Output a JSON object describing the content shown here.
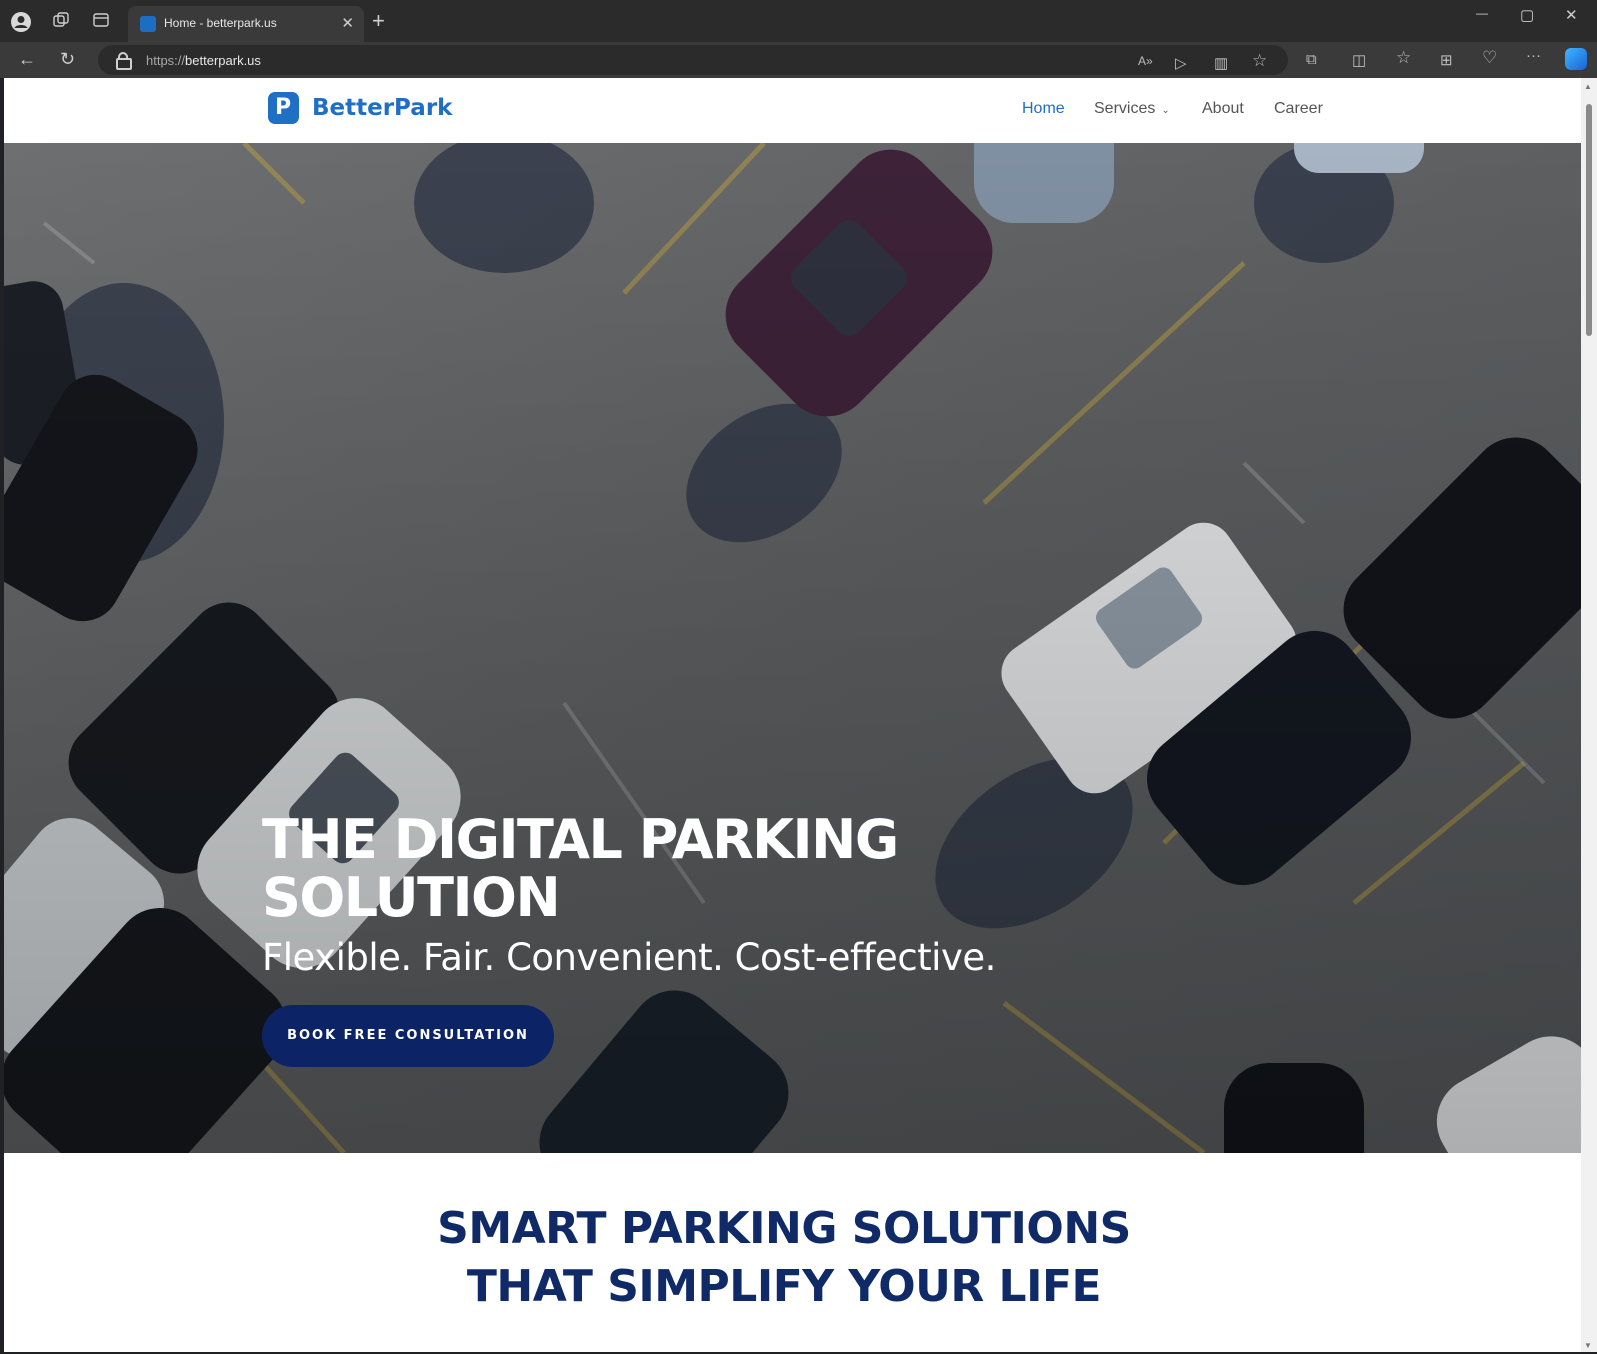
{
  "browser": {
    "tab_title": "Home - betterpark.us",
    "url_protocol": "https://",
    "url_domain": "betterpark.us",
    "icons": {
      "profile": "profile-icon",
      "workspaces": "workspaces-icon",
      "tab_actions": "tab-actions-icon",
      "new_tab": "plus-icon",
      "back": "back-arrow-icon",
      "refresh": "refresh-icon",
      "lock": "lock-icon",
      "read_aloud": "read-aloud-icon",
      "extensions": "puzzle-icon",
      "split_screen": "split-screen-icon",
      "favorites": "favorites-icon",
      "collections": "collections-icon",
      "browser_essentials": "heart-pulse-icon",
      "more": "more-dots-icon",
      "copilot": "copilot-icon"
    },
    "glyphs": {
      "tab_close": "✕",
      "new_tab": "+",
      "minimize": "—",
      "maximize": "▢",
      "window_close": "✕",
      "back": "←",
      "refresh": "↻",
      "read_aloud": "A»",
      "immersive": "▷",
      "reading_view": "▥",
      "favorite_star": "☆",
      "extensions": "⧉",
      "split": "◫",
      "favorites": "☆",
      "collections": "⊞",
      "essentials": "♡",
      "more": "···"
    }
  },
  "site": {
    "logo_text": "BetterPark",
    "logo_letter": "P",
    "brand_color": "#1f6fc5",
    "nav": {
      "home": "Home",
      "services": "Services",
      "about": "About",
      "career": "Career"
    },
    "hero": {
      "title_line1": "THE DIGITAL PARKING",
      "title_line2": "SOLUTION",
      "subtitle": "Flexible. Fair. Convenient. Cost-effective.",
      "cta": "BOOK FREE CONSULTATION",
      "cta_color": "#0c2466"
    },
    "section": {
      "title_line1": "SMART PARKING SOLUTIONS",
      "title_line2": "THAT SIMPLIFY YOUR LIFE",
      "title_color": "#0f2a66"
    }
  }
}
